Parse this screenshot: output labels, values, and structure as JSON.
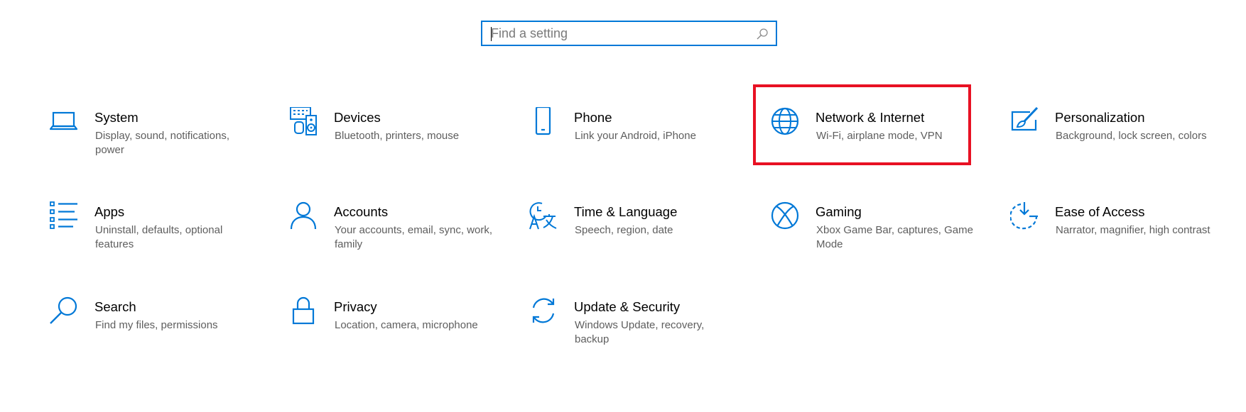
{
  "accent_color": "#0078d7",
  "highlight_color": "#e81123",
  "search": {
    "placeholder": "Find a setting",
    "value": "",
    "icon": "search-icon"
  },
  "tiles": [
    {
      "id": "system",
      "title": "System",
      "description": "Display, sound, notifications, power",
      "icon": "laptop-icon"
    },
    {
      "id": "devices",
      "title": "Devices",
      "description": "Bluetooth, printers, mouse",
      "icon": "devices-icon"
    },
    {
      "id": "phone",
      "title": "Phone",
      "description": "Link your Android, iPhone",
      "icon": "phone-icon"
    },
    {
      "id": "network",
      "title": "Network & Internet",
      "description": "Wi-Fi, airplane mode, VPN",
      "icon": "globe-icon",
      "highlighted": true
    },
    {
      "id": "personalization",
      "title": "Personalization",
      "description": "Background, lock screen, colors",
      "icon": "paint-icon"
    },
    {
      "id": "apps",
      "title": "Apps",
      "description": "Uninstall, defaults, optional features",
      "icon": "apps-list-icon"
    },
    {
      "id": "accounts",
      "title": "Accounts",
      "description": "Your accounts, email, sync, work, family",
      "icon": "person-icon"
    },
    {
      "id": "time",
      "title": "Time & Language",
      "description": "Speech, region, date",
      "icon": "time-language-icon"
    },
    {
      "id": "gaming",
      "title": "Gaming",
      "description": "Xbox Game Bar, captures, Game Mode",
      "icon": "xbox-icon"
    },
    {
      "id": "ease",
      "title": "Ease of Access",
      "description": "Narrator, magnifier, high contrast",
      "icon": "ease-of-access-icon"
    },
    {
      "id": "search",
      "title": "Search",
      "description": "Find my files, permissions",
      "icon": "magnifier-icon"
    },
    {
      "id": "privacy",
      "title": "Privacy",
      "description": "Location, camera, microphone",
      "icon": "lock-icon"
    },
    {
      "id": "update",
      "title": "Update & Security",
      "description": "Windows Update, recovery, backup",
      "icon": "sync-icon"
    }
  ]
}
